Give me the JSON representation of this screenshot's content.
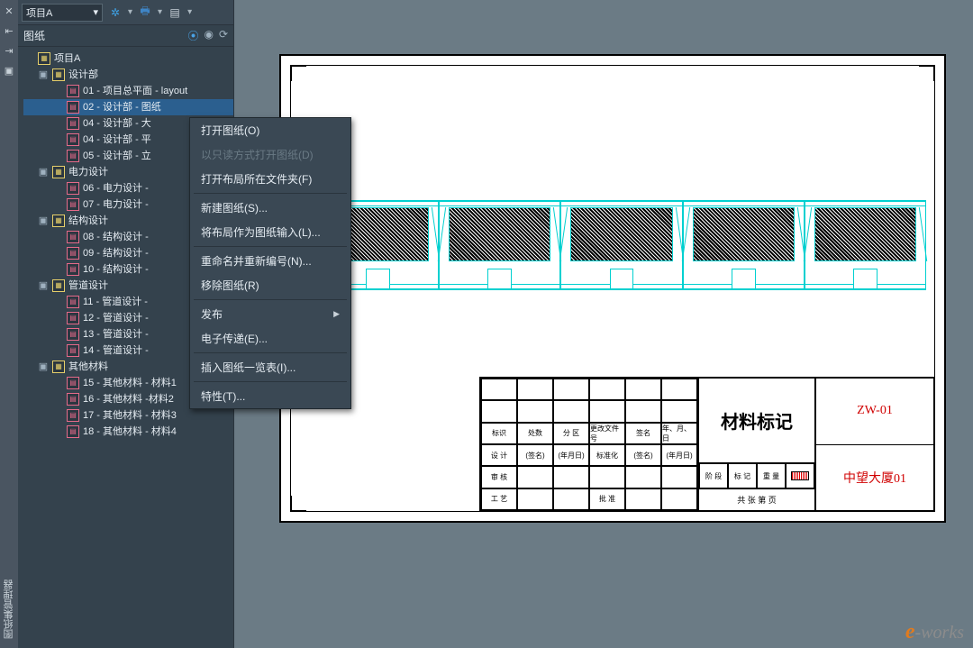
{
  "leftstrip": {
    "close_icon": "✕",
    "icons": [
      "⇤",
      "⇥",
      "▣"
    ],
    "vertical_label": "图纸集管理器"
  },
  "projectbar": {
    "combo_value": "项目A",
    "combo_caret": "▾"
  },
  "panelheader": {
    "title": "图纸",
    "icon_expand": "⦿",
    "icon_eye": "◉",
    "icon_refresh": "⟳"
  },
  "tree": [
    {
      "depth": 0,
      "type": "root",
      "icon": "folder",
      "toggle": "",
      "label": "项目A"
    },
    {
      "depth": 1,
      "type": "group",
      "icon": "folder",
      "toggle": "▣",
      "label": "设计部"
    },
    {
      "depth": 2,
      "type": "sheet",
      "icon": "sheet",
      "toggle": "",
      "label": "01 - 项目总平面 - layout"
    },
    {
      "depth": 2,
      "type": "sheet",
      "icon": "sheet",
      "toggle": "",
      "label": "02 - 设计部 - 图纸",
      "selected": true
    },
    {
      "depth": 2,
      "type": "sheet",
      "icon": "sheet",
      "toggle": "",
      "label": "04 - 设计部 - 大"
    },
    {
      "depth": 2,
      "type": "sheet",
      "icon": "sheet",
      "toggle": "",
      "label": "04 - 设计部 - 平"
    },
    {
      "depth": 2,
      "type": "sheet",
      "icon": "sheet",
      "toggle": "",
      "label": "05 - 设计部 - 立"
    },
    {
      "depth": 1,
      "type": "group",
      "icon": "folder",
      "toggle": "▣",
      "label": "电力设计"
    },
    {
      "depth": 2,
      "type": "sheet",
      "icon": "sheet",
      "toggle": "",
      "label": "06 - 电力设计 -"
    },
    {
      "depth": 2,
      "type": "sheet",
      "icon": "sheet",
      "toggle": "",
      "label": "07 - 电力设计 -"
    },
    {
      "depth": 1,
      "type": "group",
      "icon": "folder",
      "toggle": "▣",
      "label": "结构设计"
    },
    {
      "depth": 2,
      "type": "sheet",
      "icon": "sheet",
      "toggle": "",
      "label": "08 - 结构设计 -"
    },
    {
      "depth": 2,
      "type": "sheet",
      "icon": "sheet",
      "toggle": "",
      "label": "09 - 结构设计 -"
    },
    {
      "depth": 2,
      "type": "sheet",
      "icon": "sheet",
      "toggle": "",
      "label": "10 - 结构设计 -"
    },
    {
      "depth": 1,
      "type": "group",
      "icon": "folder",
      "toggle": "▣",
      "label": "管道设计"
    },
    {
      "depth": 2,
      "type": "sheet",
      "icon": "sheet",
      "toggle": "",
      "label": "11 - 管道设计 -"
    },
    {
      "depth": 2,
      "type": "sheet",
      "icon": "sheet",
      "toggle": "",
      "label": "12 - 管道设计 -"
    },
    {
      "depth": 2,
      "type": "sheet",
      "icon": "sheet",
      "toggle": "",
      "label": "13 - 管道设计 -"
    },
    {
      "depth": 2,
      "type": "sheet",
      "icon": "sheet",
      "toggle": "",
      "label": "14 - 管道设计 -"
    },
    {
      "depth": 1,
      "type": "group",
      "icon": "folder",
      "toggle": "▣",
      "label": "其他材料"
    },
    {
      "depth": 2,
      "type": "sheet",
      "icon": "sheet",
      "toggle": "",
      "label": "15 - 其他材料 - 材料1"
    },
    {
      "depth": 2,
      "type": "sheet",
      "icon": "sheet",
      "toggle": "",
      "label": "16 - 其他材料 -材料2"
    },
    {
      "depth": 2,
      "type": "sheet",
      "icon": "sheet",
      "toggle": "",
      "label": "17 - 其他材料 - 材料3"
    },
    {
      "depth": 2,
      "type": "sheet",
      "icon": "sheet",
      "toggle": "",
      "label": "18 - 其他材料 - 材料4"
    }
  ],
  "contextmenu": [
    {
      "label": "打开图纸(O)",
      "type": "item"
    },
    {
      "label": "以只读方式打开图纸(D)",
      "type": "disabled"
    },
    {
      "label": "打开布局所在文件夹(F)",
      "type": "item"
    },
    {
      "type": "sep"
    },
    {
      "label": "新建图纸(S)...",
      "type": "item"
    },
    {
      "label": "将布局作为图纸输入(L)...",
      "type": "item"
    },
    {
      "type": "sep"
    },
    {
      "label": "重命名并重新编号(N)...",
      "type": "item"
    },
    {
      "label": "移除图纸(R)",
      "type": "item"
    },
    {
      "type": "sep"
    },
    {
      "label": "发布",
      "type": "submenu"
    },
    {
      "label": "电子传递(E)...",
      "type": "item"
    },
    {
      "type": "sep"
    },
    {
      "label": "插入图纸一览表(I)...",
      "type": "item"
    },
    {
      "type": "sep"
    },
    {
      "label": "特性(T)...",
      "type": "item"
    }
  ],
  "titleblock": {
    "main_title": "材料标记",
    "headers": [
      "标识",
      "处数",
      "分 区",
      "更改文件号",
      "签名",
      "年、月、日"
    ],
    "row_design": [
      "设 计",
      "(签名)",
      "(年月日)",
      "标准化",
      "(签名)",
      "(年月日)"
    ],
    "row_audit": "审 核",
    "row_process": "工 艺",
    "row_approve": "批 准",
    "mid_cells": [
      "阶 段",
      "标 记",
      "重 量",
      "比例"
    ],
    "sheet_count": "共    张   第    页",
    "code": "ZW-01",
    "project": "中望大厦01"
  },
  "watermark": {
    "e": "e",
    "works": "-works"
  }
}
